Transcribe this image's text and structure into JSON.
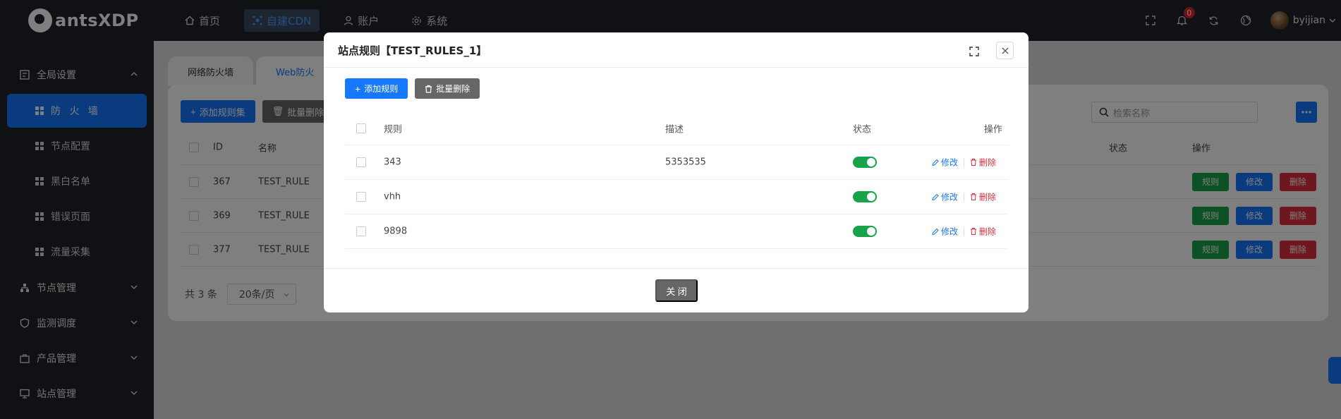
{
  "app": {
    "logo_text": "antsXDP"
  },
  "topnav": [
    {
      "label": "首页",
      "icon": "home-icon",
      "active": false
    },
    {
      "label": "自建CDN",
      "icon": "cdn-icon",
      "active": true
    },
    {
      "label": "账户",
      "icon": "user-icon",
      "active": false
    },
    {
      "label": "系统",
      "icon": "gear-icon",
      "active": false
    }
  ],
  "topright": {
    "notification_count": "0",
    "username": "byijian"
  },
  "sidebar": {
    "groups": [
      {
        "label": "全局设置",
        "icon": "settings-panel-icon",
        "expanded": true
      },
      {
        "label": "节点管理",
        "icon": "node-tree-icon"
      },
      {
        "label": "监测调度",
        "icon": "shield-icon"
      },
      {
        "label": "产品管理",
        "icon": "briefcase-icon"
      },
      {
        "label": "站点管理",
        "icon": "monitor-icon"
      }
    ],
    "items": [
      {
        "label": "防 火 墙",
        "active": true
      },
      {
        "label": "节点配置",
        "active": false
      },
      {
        "label": "黑白名单",
        "active": false
      },
      {
        "label": "错误页面",
        "active": false
      },
      {
        "label": "流量采集",
        "active": false
      }
    ]
  },
  "tabs": [
    {
      "label": "网络防火墙",
      "active": false
    },
    {
      "label": "Web防火",
      "active": true
    }
  ],
  "toolbar": {
    "add_label": "添加规则集",
    "batch_delete_label": "批量删除"
  },
  "search": {
    "placeholder": "检索名称"
  },
  "bg_table": {
    "headers": {
      "id": "ID",
      "name": "名称",
      "status": "状态",
      "ops": "操作"
    },
    "rows": [
      {
        "id": "367",
        "name": "TEST_RULE"
      },
      {
        "id": "369",
        "name": "TEST_RULE"
      },
      {
        "id": "377",
        "name": "TEST_RULE"
      }
    ],
    "row_buttons": {
      "rules": "规则",
      "edit": "修改",
      "delete": "删除"
    }
  },
  "pager": {
    "total": "共 3 条",
    "page_size": "20条/页"
  },
  "modal": {
    "title": "站点规则【TEST_RULES_1】",
    "add_label": "添加规则",
    "batch_delete_label": "批量删除",
    "headers": {
      "rule": "规则",
      "desc": "描述",
      "status": "状态",
      "ops": "操作"
    },
    "rows": [
      {
        "rule": "343",
        "desc": "5353535",
        "enabled": true
      },
      {
        "rule": "vhh",
        "desc": "",
        "enabled": true
      },
      {
        "rule": "9898",
        "desc": "",
        "enabled": true
      }
    ],
    "edit_label": "修改",
    "delete_label": "删除",
    "close_label": "关 闭"
  },
  "colors": {
    "primary": "#1677ff",
    "success": "#18a34a",
    "danger": "#e02c3c",
    "dark_bg": "#1f2329"
  }
}
